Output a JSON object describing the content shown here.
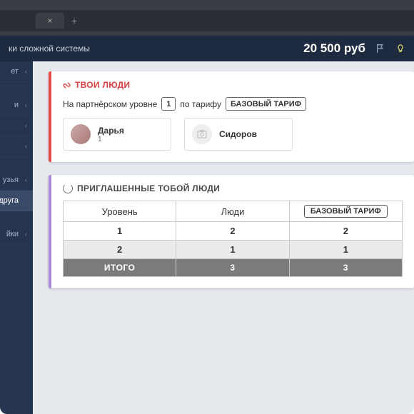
{
  "header": {
    "page_title_fragment": "ки сложной системы",
    "balance": "20 500 руб"
  },
  "sidebar": {
    "items": [
      {
        "label": "ет"
      },
      {
        "label": "и"
      },
      {
        "label": ""
      },
      {
        "label": ""
      },
      {
        "label": "узья"
      },
      {
        "label": "друга"
      },
      {
        "label": "йки"
      }
    ]
  },
  "card_people": {
    "title": "ТВОИ ЛЮДИ",
    "filter_prefix": "На партнёрском уровне",
    "filter_level": "1",
    "filter_tariff_label": "по тарифу",
    "filter_tariff_value": "БАЗОВЫЙ ТАРИФ",
    "people": [
      {
        "name": "Дарья",
        "sub": "1",
        "has_photo": true
      },
      {
        "name": "Сидоров",
        "sub": "",
        "has_photo": false
      }
    ]
  },
  "card_invited": {
    "title": "ПРИГЛАШЕННЫЕ ТОБОЙ ЛЮДИ",
    "columns": {
      "level": "Уровень",
      "people": "Люди",
      "tariff": "БАЗОВЫЙ ТАРИФ"
    },
    "rows": [
      {
        "level": "1",
        "people": "2",
        "tariff": "2"
      },
      {
        "level": "2",
        "people": "1",
        "tariff": "1"
      }
    ],
    "total": {
      "label": "ИТОГО",
      "people": "3",
      "tariff": "3"
    }
  }
}
